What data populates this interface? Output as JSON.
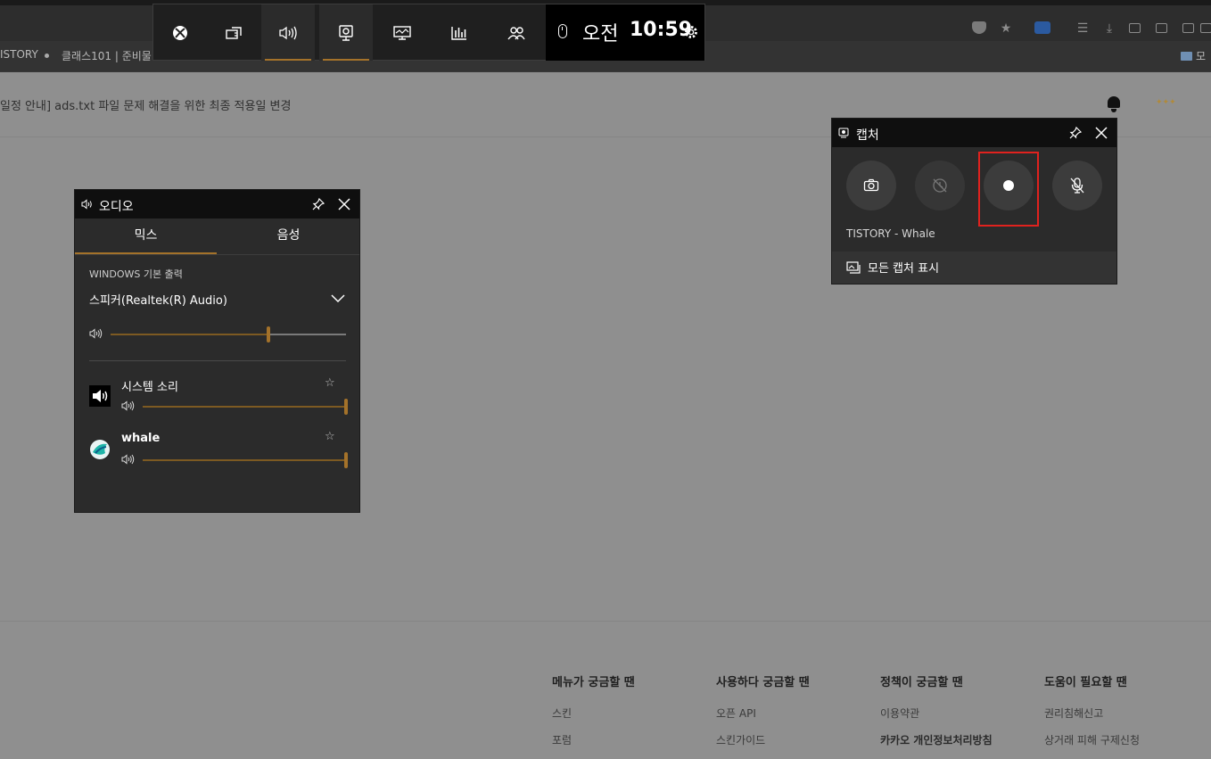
{
  "browser": {
    "bookmarks": {
      "item1": "ISTORY",
      "item2": "클래스101 | 준비물",
      "right_folder": "모"
    },
    "notice": "일정 안내] ads.txt 파일 문제 해결을 위한 최종 적용일 변경"
  },
  "footer": {
    "columns": [
      {
        "heading": "메뉴가 궁금할 땐",
        "links": [
          "스킨",
          "포럼"
        ]
      },
      {
        "heading": "사용하다 궁금할 땐",
        "links": [
          "오픈 API",
          "스킨가이드"
        ]
      },
      {
        "heading": "정책이 궁금할 땐",
        "links": [
          "이용약관",
          "카카오 개인정보처리방침"
        ]
      },
      {
        "heading": "도움이 필요할 땐",
        "links": [
          "권리침해신고",
          "상거래 피해 구제신청"
        ]
      }
    ]
  },
  "gamebar": {
    "buttons": [
      {
        "icon": "xbox-icon",
        "active": false
      },
      {
        "icon": "widget-menu-icon",
        "active": false
      },
      {
        "icon": "audio-icon",
        "active": true
      },
      {
        "icon": "capture-icon",
        "active": true
      },
      {
        "icon": "performance-icon",
        "active": false
      },
      {
        "icon": "resources-icon",
        "active": false
      },
      {
        "icon": "social-icon",
        "active": false
      }
    ],
    "ampm": "오전",
    "time": "10:59"
  },
  "audio_widget": {
    "title": "오디오",
    "tabs": [
      "믹스",
      "음성"
    ],
    "selected_tab": "믹스",
    "section_label": "WINDOWS 기본 출력",
    "device": "스피커(Realtek(R) Audio)",
    "master_volume": 0.67,
    "apps": [
      {
        "name": "시스템 소리",
        "volume": 1.0
      },
      {
        "name": "whale",
        "volume": 1.0
      }
    ]
  },
  "capture_widget": {
    "title": "캡처",
    "source": "TISTORY - Whale",
    "show_all": "모든 캡처 표시",
    "accent_color": "#a4722a",
    "highlight_color": "#e0221e"
  }
}
